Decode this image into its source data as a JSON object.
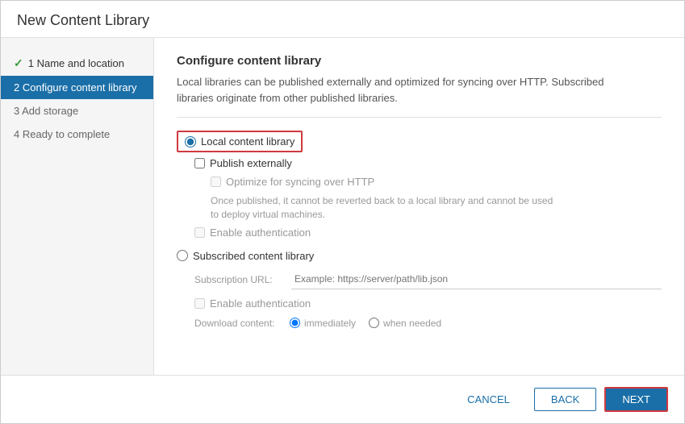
{
  "dialog": {
    "title": "New Content Library"
  },
  "sidebar": {
    "items": [
      {
        "id": "step1",
        "label": "1 Name and location",
        "state": "completed"
      },
      {
        "id": "step2",
        "label": "2 Configure content library",
        "state": "active"
      },
      {
        "id": "step3",
        "label": "3 Add storage",
        "state": "default"
      },
      {
        "id": "step4",
        "label": "4 Ready to complete",
        "state": "default"
      }
    ]
  },
  "main": {
    "section_title": "Configure content library",
    "section_desc1": "Local libraries can be published externally and optimized for syncing over HTTP. Subscribed",
    "section_desc2": "libraries originate from other published libraries.",
    "local_library_label": "Local content library",
    "publish_externally_label": "Publish externally",
    "optimize_label": "Optimize for syncing over HTTP",
    "optimize_note": "Once published, it cannot be reverted back to a local library and cannot be used\nto deploy virtual machines.",
    "enable_auth_local_label": "Enable authentication",
    "subscribed_library_label": "Subscribed content library",
    "subscription_url_label": "Subscription URL:",
    "subscription_url_placeholder": "Example: https://server/path/lib.json",
    "enable_auth_sub_label": "Enable authentication",
    "download_content_label": "Download content:",
    "immediately_label": "immediately",
    "when_needed_label": "when needed"
  },
  "footer": {
    "cancel_label": "CANCEL",
    "back_label": "BACK",
    "next_label": "NEXT"
  }
}
